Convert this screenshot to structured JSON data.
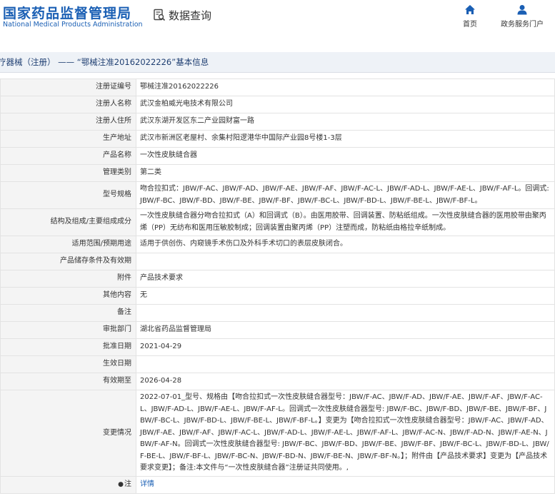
{
  "header": {
    "logo_cn": "国家药品监督管理局",
    "logo_en": "National Medical Products Administration",
    "query_label": "数据查询",
    "nav": [
      {
        "icon": "home-icon",
        "label": "首页"
      },
      {
        "icon": "user-icon",
        "label": "政务服务门户"
      }
    ],
    "brand_color": "#1a5fb4"
  },
  "breadcrumb": "疗器械（注册） —— “鄂械注准20162022226”基本信息",
  "rows": [
    {
      "label": "注册证编号",
      "value": "鄂械注准20162022226"
    },
    {
      "label": "注册人名称",
      "value": "武汉金柏威光电技术有限公司"
    },
    {
      "label": "注册人住所",
      "value": "武汉东湖开发区东二产业园财富一路"
    },
    {
      "label": "生产地址",
      "value": "武汉市新洲区老屋村、余集村阳逻港华中国际产业园8号楼1-3层"
    },
    {
      "label": "产品名称",
      "value": "一次性皮肤缝合器"
    },
    {
      "label": "管理类别",
      "value": "第二类"
    },
    {
      "label": "型号规格",
      "value": "吻合拉扣式：JBW/F-AC、JBW/F-AD、JBW/F-AE、JBW/F-AF、JBW/F-AC-L、JBW/F-AD-L、JBW/F-AE-L、JBW/F-AF-L。回调式: JBW/F-BC、JBW/F-BD、JBW/F-BE、JBW/F-BF、JBW/F-BC-L、JBW/F-BD-L、JBW/F-BE-L、JBW/F-BF-L。"
    },
    {
      "label": "结构及组成/主要组成成分",
      "value": "一次性皮肤缝合器分吻合拉扣式（A）和回调式（B）。由医用胶带、回调装置、防粘纸组成。一次性皮肤缝合器的医用胶带由聚丙烯（PP）无纺布和医用压敏胶制成；回调装置由聚丙烯（PP）注塑而成，防粘纸由格拉辛纸制成。"
    },
    {
      "label": "适用范围/预期用途",
      "value": "适用于供创伤、内窥镜手术伤口及外科手术切口的表层皮肤闭合。"
    },
    {
      "label": "产品储存条件及有效期",
      "value": ""
    },
    {
      "label": "附件",
      "value": "产品技术要求"
    },
    {
      "label": "其他内容",
      "value": "无"
    },
    {
      "label": "备注",
      "value": ""
    },
    {
      "label": "审批部门",
      "value": "湖北省药品监督管理局"
    },
    {
      "label": "批准日期",
      "value": "2021-04-29"
    },
    {
      "label": "生效日期",
      "value": ""
    },
    {
      "label": "有效期至",
      "value": "2026-04-28"
    },
    {
      "label": "变更情况",
      "value": "2022-07-01_型号、规格由【吻合拉扣式一次性皮肤缝合器型号：JBW/F-AC、JBW/F-AD、JBW/F-AE、JBW/F-AF、JBW/F-AC-L、JBW/F-AD-L、JBW/F-AE-L、JBW/F-AF-L。回调式一次性皮肤缝合器型号: JBW/F-BC、JBW/F-BD、JBW/F-BE、JBW/F-BF、JBW/F-BC-L、JBW/F-BD-L、JBW/F-BE-L、JBW/F-BF-L。】变更为【吻合拉扣式一次性皮肤缝合器型号：JBW/F-AC、JBW/F-AD、JBW/F-AE、JBW/F-AF、JBW/F-AC-L、JBW/F-AD-L、JBW/F-AE-L、JBW/F-AF-L、JBW/F-AC-N、JBW/F-AD-N、JBW/F-AE-N、JBW/F-AF-N。回调式一次性皮肤缝合器型号: JBW/F-BC、JBW/F-BD、JBW/F-BE、JBW/F-BF、JBW/F-BC-L、JBW/F-BD-L、JBW/F-BE-L、JBW/F-BF-L、JBW/F-BC-N、JBW/F-BD-N、JBW/F-BE-N、JBW/F-BF-N。】；附件由【产品技术要求】变更为【产品技术要求变更】；备注:本文件与“一次性皮肤缝合器”注册证共同使用。,"
    }
  ],
  "note": {
    "label": "注",
    "pin_icon": "pin-icon",
    "link": "详情"
  }
}
